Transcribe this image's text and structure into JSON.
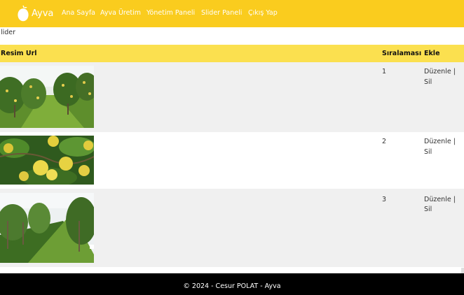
{
  "nav": {
    "brand": "Ayva",
    "links": [
      "Ana Sayfa",
      "Ayva Üretim",
      "Yönetim Paneli",
      "Slider Paneli",
      "Çıkış Yap"
    ]
  },
  "page": {
    "heading": "lider"
  },
  "table": {
    "headers": [
      "Resim Url",
      "Sıralaması",
      "Ekle"
    ],
    "rows": [
      {
        "order": "1",
        "edit": "Düzenle |",
        "delete": "Sil"
      },
      {
        "order": "2",
        "edit": "Düzenle |",
        "delete": "Sil"
      },
      {
        "order": "3",
        "edit": "Düzenle |",
        "delete": "Sil"
      }
    ]
  },
  "footer": {
    "text": "© 2024 - Cesur POLAT - Ayva"
  },
  "colors": {
    "navbar": "#facc1e",
    "table_header": "#fbe04f",
    "row_stripe": "#f0f0f0",
    "footer": "#000000"
  }
}
